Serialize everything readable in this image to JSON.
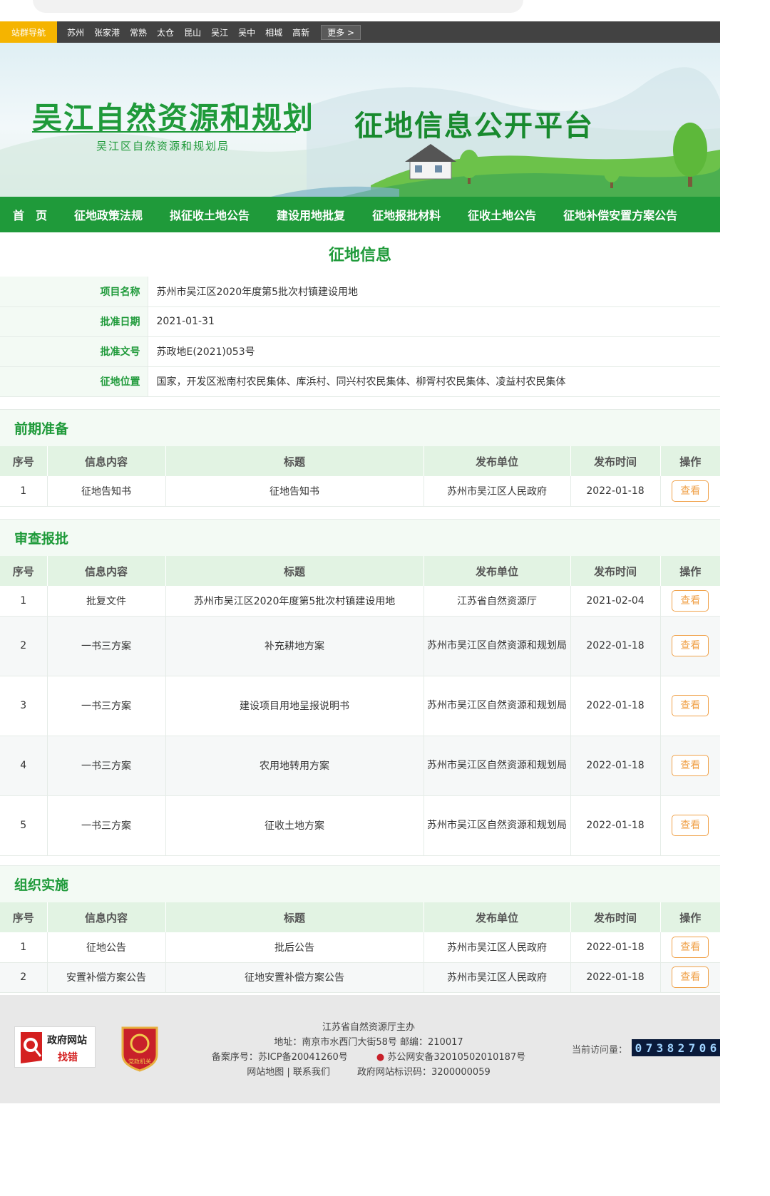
{
  "site_nav": {
    "label": "站群导航",
    "cities": [
      "苏州",
      "张家港",
      "常熟",
      "太仓",
      "昆山",
      "吴江",
      "吴中",
      "相城",
      "高新"
    ],
    "more": "更多 >"
  },
  "banner": {
    "brand_title": "吴江自然资源和规划",
    "brand_subtitle": "吴江区自然资源和规划局",
    "platform_title": "征地信息公开平台"
  },
  "main_nav": [
    "首　页",
    "征地政策法规",
    "拟征收土地公告",
    "建设用地批复",
    "征地报批材料",
    "征收土地公告",
    "征地补偿安置方案公告"
  ],
  "page_title": "征地信息",
  "info": [
    {
      "key": "项目名称",
      "value": "苏州市吴江区2020年度第5批次村镇建设用地"
    },
    {
      "key": "批准日期",
      "value": "2021-01-31"
    },
    {
      "key": "批准文号",
      "value": "苏政地E(2021)053号"
    },
    {
      "key": "征地位置",
      "value": "国家，开发区淞南村农民集体、库浜村、同兴村农民集体、柳胥村农民集体、凌益村农民集体"
    }
  ],
  "table_headers": [
    "序号",
    "信息内容",
    "标题",
    "发布单位",
    "发布时间",
    "操作"
  ],
  "view_label": "查看",
  "sections": [
    {
      "title": "前期准备",
      "rows": [
        {
          "no": "1",
          "content": "征地告知书",
          "title": "征地告知书",
          "unit": "苏州市吴江区人民政府",
          "date": "2022-01-18"
        }
      ]
    },
    {
      "title": "审查报批",
      "rows": [
        {
          "no": "1",
          "content": "批复文件",
          "title": "苏州市吴江区2020年度第5批次村镇建设用地",
          "unit": "江苏省自然资源厅",
          "date": "2021-02-04"
        },
        {
          "no": "2",
          "content": "一书三方案",
          "title": "补充耕地方案",
          "unit": "苏州市吴江区自然资源和规划局",
          "date": "2022-01-18"
        },
        {
          "no": "3",
          "content": "一书三方案",
          "title": "建设项目用地呈报说明书",
          "unit": "苏州市吴江区自然资源和规划局",
          "date": "2022-01-18"
        },
        {
          "no": "4",
          "content": "一书三方案",
          "title": "农用地转用方案",
          "unit": "苏州市吴江区自然资源和规划局",
          "date": "2022-01-18"
        },
        {
          "no": "5",
          "content": "一书三方案",
          "title": "征收土地方案",
          "unit": "苏州市吴江区自然资源和规划局",
          "date": "2022-01-18"
        }
      ]
    },
    {
      "title": "组织实施",
      "rows": [
        {
          "no": "1",
          "content": "征地公告",
          "title": "批后公告",
          "unit": "苏州市吴江区人民政府",
          "date": "2022-01-18"
        },
        {
          "no": "2",
          "content": "安置补偿方案公告",
          "title": "征地安置补偿方案公告",
          "unit": "苏州市吴江区人民政府",
          "date": "2022-01-18"
        }
      ]
    }
  ],
  "footer": {
    "host": "江苏省自然资源厅主办",
    "address": "地址：南京市水西门大街58号 邮编：210017",
    "icp": "备案序号：苏ICP备20041260号",
    "police": "苏公网安备32010502010187号",
    "links": "网站地图 | 联系我们",
    "site_code": "政府网站标识码：3200000059",
    "gov_badge_line1": "政府网站",
    "gov_badge_line2": "找错",
    "party_badge_text": "党政机关",
    "visit_label": "当前访问量：",
    "visit_count": "07382706"
  }
}
